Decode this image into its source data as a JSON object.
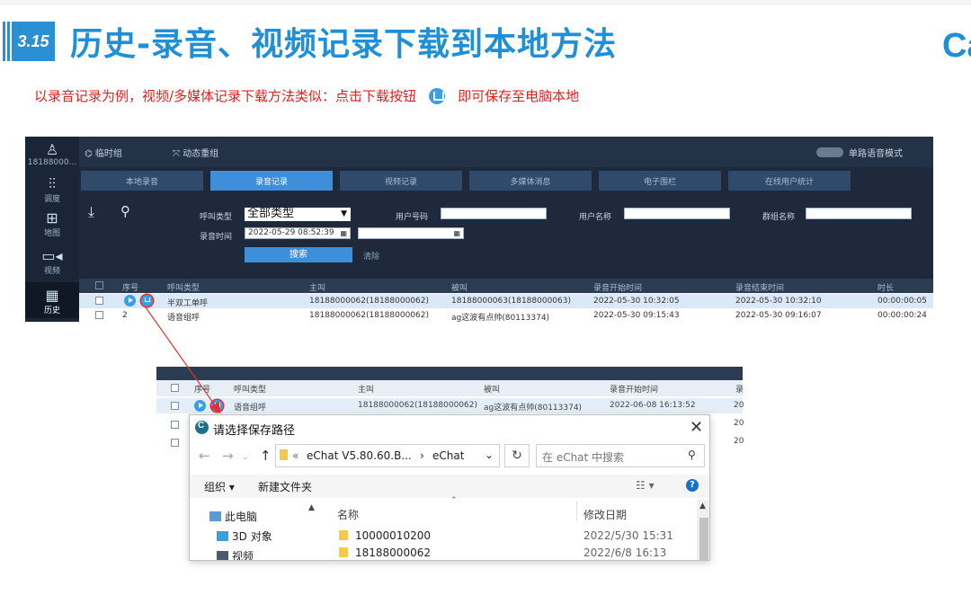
{
  "slide": {
    "badge": "3.15",
    "title": "历史-录音、视频记录下载到本地方法",
    "corner_logo": "Ca",
    "subtitle_before": "以录音记录为例，视频/多媒体记录下载方法类似：点击下载按钮",
    "subtitle_after": "即可保存至电脑本地"
  },
  "app1": {
    "sidebar": [
      {
        "icon": "user-icon",
        "label": "18188000..."
      },
      {
        "icon": "wave-icon",
        "label": "调度"
      },
      {
        "icon": "map-icon",
        "label": "地图"
      },
      {
        "icon": "video-icon",
        "label": "视频"
      },
      {
        "icon": "history-icon",
        "label": "历史"
      }
    ],
    "topbar": {
      "temp_call": "临时组",
      "dynamic_regroup": "动态重组",
      "mode_label": "单路语音模式"
    },
    "tabs": [
      "本地录音",
      "录音记录",
      "视频记录",
      "多媒体消息",
      "电子围栏",
      "在线用户统计"
    ],
    "active_tab": "录音记录",
    "filters": {
      "call_type_label": "呼叫类型",
      "call_type_value": "全部类型",
      "user_number_label": "用户号码",
      "user_name_label": "用户名称",
      "group_name_label": "群组名称",
      "record_time_label": "录音时间",
      "start_time": "2022-05-29 08:52:39",
      "search_button": "搜索",
      "clear_button": "清除"
    },
    "table": {
      "headers": [
        "序号",
        "呼叫类型",
        "主叫",
        "被叫",
        "录音开始时间",
        "录音结束时间",
        "时长"
      ],
      "rows": [
        {
          "no": "",
          "type": "半双工单呼",
          "caller": "18188000062(18188000062)",
          "callee": "18188000063(18188000063)",
          "start": "2022-05-30 10:32:05",
          "end": "2022-05-30 10:32:10",
          "duration": "00:00:00:05"
        },
        {
          "no": "2",
          "type": "语音组呼",
          "caller": "18188000062(18188000062)",
          "callee": "ag这波有点帅(80113374)",
          "start": "2022-05-30 09:15:43",
          "end": "2022-05-30 09:16:07",
          "duration": "00:00:00:24"
        }
      ]
    }
  },
  "app2": {
    "headers": [
      "序号",
      "呼叫类型",
      "主叫",
      "被叫",
      "录音开始时间",
      "录"
    ],
    "row": {
      "type": "语音组呼",
      "caller": "18188000062(18188000062)",
      "callee": "ag这波有点帅(80113374)",
      "start": "2022-06-08 16:13:52",
      "end": "20"
    },
    "row_tail": [
      "20",
      "20"
    ]
  },
  "dialog": {
    "title": "请选择保存路径",
    "address_prefix": "«",
    "address_path1": "eChat V5.80.60.B...",
    "address_path2": "eChat",
    "search_placeholder": "在 eChat 中搜索",
    "organize": "组织 ▾",
    "new_folder": "新建文件夹",
    "nav_items": [
      "此电脑",
      "3D 对象",
      "视频"
    ],
    "col_name": "名称",
    "col_modified": "修改日期",
    "files": [
      {
        "name": "10000010200",
        "modified": "2022/5/30 15:31"
      },
      {
        "name": "18188000062",
        "modified": "2022/6/8 16:13"
      }
    ]
  }
}
